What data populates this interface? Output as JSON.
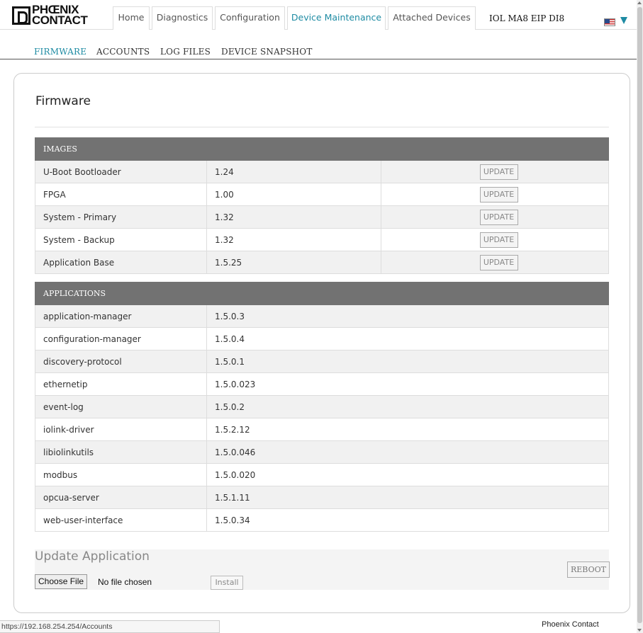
{
  "header": {
    "logo_line1": "PHŒNIX",
    "logo_line2": "CONTACT",
    "tabs": [
      {
        "label": "Home"
      },
      {
        "label": "Diagnostics"
      },
      {
        "label": "Configuration"
      },
      {
        "label": "Device Maintenance"
      },
      {
        "label": "Attached Devices"
      }
    ],
    "active_tab": "Device Maintenance",
    "device_name": "IOL MA8 EIP DI8"
  },
  "subnav": {
    "items": [
      {
        "label": "FIRMWARE"
      },
      {
        "label": "ACCOUNTS"
      },
      {
        "label": "LOG FILES"
      },
      {
        "label": "DEVICE SNAPSHOT"
      }
    ],
    "active": "FIRMWARE"
  },
  "page": {
    "title": "Firmware"
  },
  "images_table": {
    "header": "IMAGES",
    "button_label": "UPDATE",
    "rows": [
      {
        "name": "U-Boot Bootloader",
        "version": "1.24"
      },
      {
        "name": "FPGA",
        "version": "1.00"
      },
      {
        "name": "System - Primary",
        "version": "1.32"
      },
      {
        "name": "System - Backup",
        "version": "1.32"
      },
      {
        "name": "Application Base",
        "version": "1.5.25"
      }
    ]
  },
  "applications_table": {
    "header": "APPLICATIONS",
    "rows": [
      {
        "name": "application-manager",
        "version": "1.5.0.3"
      },
      {
        "name": "configuration-manager",
        "version": "1.5.0.4"
      },
      {
        "name": "discovery-protocol",
        "version": "1.5.0.1"
      },
      {
        "name": "ethernetip",
        "version": "1.5.0.023"
      },
      {
        "name": "event-log",
        "version": "1.5.0.2"
      },
      {
        "name": "iolink-driver",
        "version": "1.5.2.12"
      },
      {
        "name": "libiolinkutils",
        "version": "1.5.0.046"
      },
      {
        "name": "modbus",
        "version": "1.5.0.020"
      },
      {
        "name": "opcua-server",
        "version": "1.5.1.11"
      },
      {
        "name": "web-user-interface",
        "version": "1.5.0.34"
      }
    ]
  },
  "update_application": {
    "title": "Update Application",
    "choose_file_label": "Choose File",
    "no_file_text": "No file chosen",
    "install_label": "Install",
    "reboot_label": "REBOOT"
  },
  "statusbar": {
    "url": "https://192.168.254.254/Accounts",
    "brand": "Phoenix Contact"
  },
  "colors": {
    "accent": "#1e8ba3",
    "table_header": "#727272",
    "row_alt": "#f1f1f1"
  }
}
